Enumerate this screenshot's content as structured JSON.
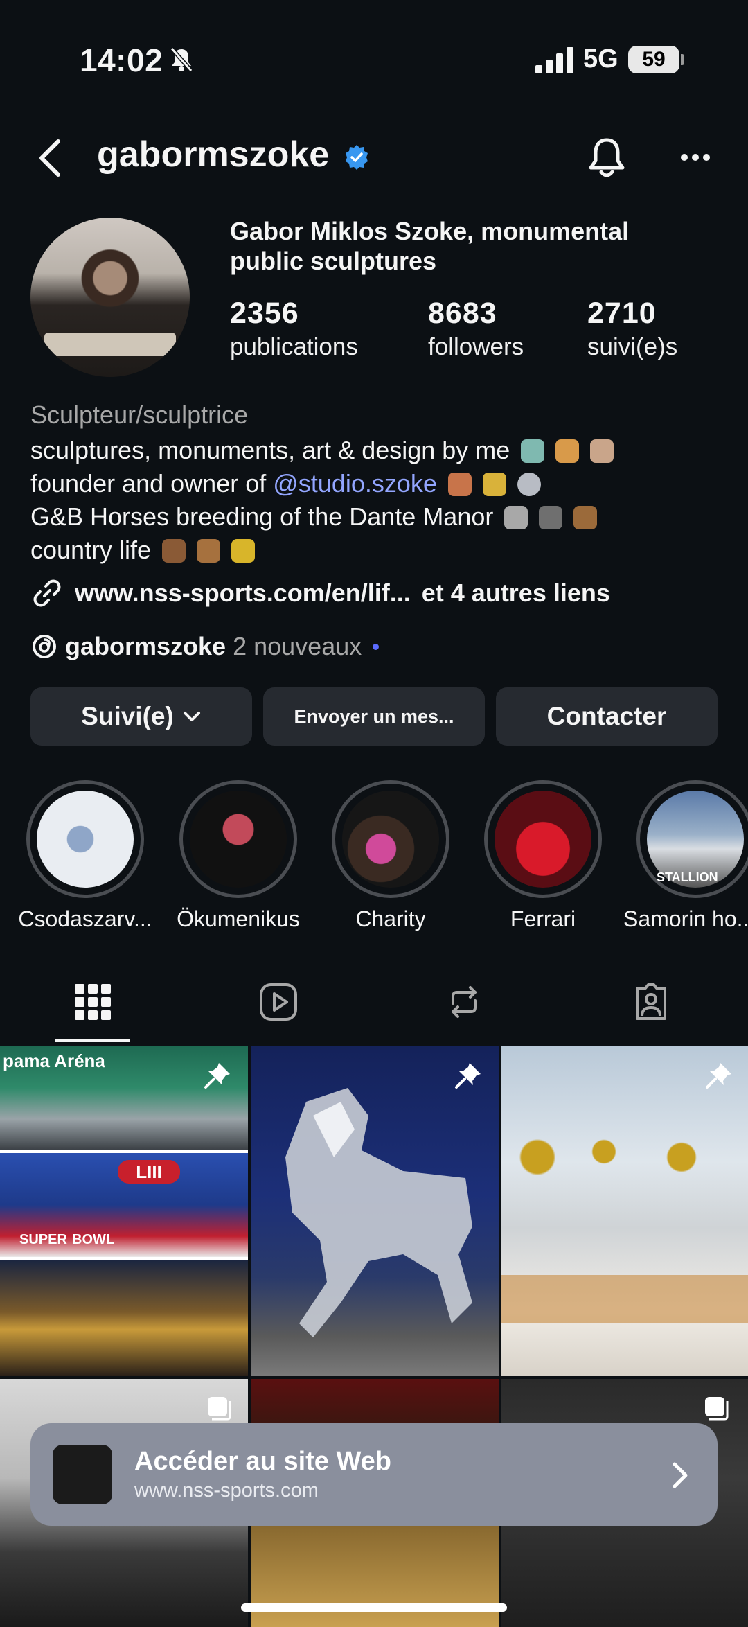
{
  "status_bar": {
    "time": "14:02",
    "network": "5G",
    "battery": "59"
  },
  "header": {
    "username": "gabormszoke"
  },
  "profile": {
    "full_name": "Gabor Miklos Szoke, monumental public sculptures",
    "stats": [
      {
        "value": "2356",
        "label": "publications"
      },
      {
        "value": "8683",
        "label": "followers"
      },
      {
        "value": "2710",
        "label": "suivi(e)s"
      }
    ],
    "category": "Sculpteur/sculptrice",
    "bio": {
      "line1": "sculptures, monuments, art & design by me",
      "line2_prefix": "founder and owner of ",
      "line2_mention": "@studio.szoke",
      "line3": "G&B Horses breeding of the Dante Manor",
      "line4": "country life"
    },
    "link": {
      "url": "www.nss-sports.com/en/lif...",
      "more": "et 4 autres liens"
    },
    "threads": {
      "handle": "gabormszoke",
      "new_count": "2 nouveaux"
    }
  },
  "actions": {
    "following": "Suivi(e)",
    "message": "Envoyer un mes...",
    "contact": "Contacter"
  },
  "highlights": [
    {
      "label": "Csodaszarv..."
    },
    {
      "label": "Ökumenikus"
    },
    {
      "label": "Charity"
    },
    {
      "label": "Ferrari"
    },
    {
      "label": "Samorin ho..."
    }
  ],
  "tabs": [
    {
      "icon": "grid-icon",
      "active": true
    },
    {
      "icon": "reels-icon",
      "active": false
    },
    {
      "icon": "reposts-icon",
      "active": false
    },
    {
      "icon": "tagged-icon",
      "active": false
    }
  ],
  "posts": {
    "post1_signs": [
      "pama Aréna",
      "LIII",
      "SUPER",
      "BOWL"
    ],
    "post3_signs": [
      "STALLION"
    ]
  },
  "banner": {
    "title": "Accéder au site Web",
    "url": "www.nss-sports.com"
  },
  "colors": {
    "background": "#0c1014",
    "mention": "#93a6ff",
    "button": "#262a30",
    "banner": "#8a8f9d",
    "verified": "#3897f0"
  }
}
